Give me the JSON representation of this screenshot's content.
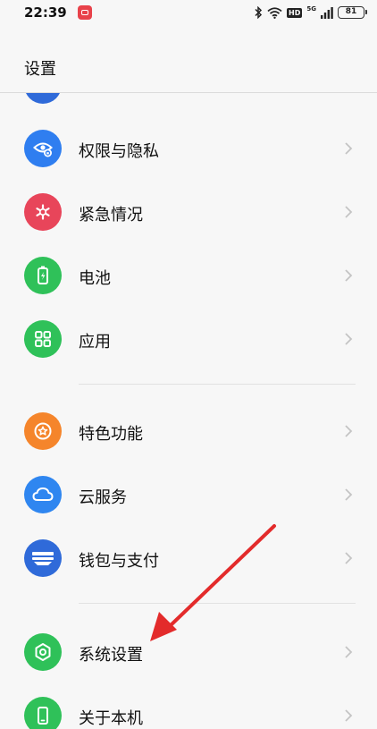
{
  "status_bar": {
    "time": "22:39",
    "hd": "HD",
    "network": "5G",
    "battery": "81"
  },
  "header": {
    "title": "设置"
  },
  "menu": [
    {
      "label": "权限与隐私",
      "color": "#2f7ef0",
      "icon": "privacy-eye-icon"
    },
    {
      "label": "紧急情况",
      "color": "#e8455a",
      "icon": "emergency-asterisk-icon"
    },
    {
      "label": "电池",
      "color": "#2fc159",
      "icon": "battery-icon"
    },
    {
      "label": "应用",
      "color": "#2fc159",
      "icon": "apps-grid-icon"
    },
    {
      "label": "特色功能",
      "color": "#f5852b",
      "icon": "star-badge-icon"
    },
    {
      "label": "云服务",
      "color": "#2f86f0",
      "icon": "cloud-icon"
    },
    {
      "label": "钱包与支付",
      "color": "#2f6ad9",
      "icon": "wallet-icon"
    },
    {
      "label": "系统设置",
      "color": "#2fc159",
      "icon": "hexagon-settings-icon"
    },
    {
      "label": "关于本机",
      "color": "#2fc159",
      "icon": "phone-icon"
    }
  ],
  "annotation": {
    "arrow_color": "#e32b2b"
  }
}
